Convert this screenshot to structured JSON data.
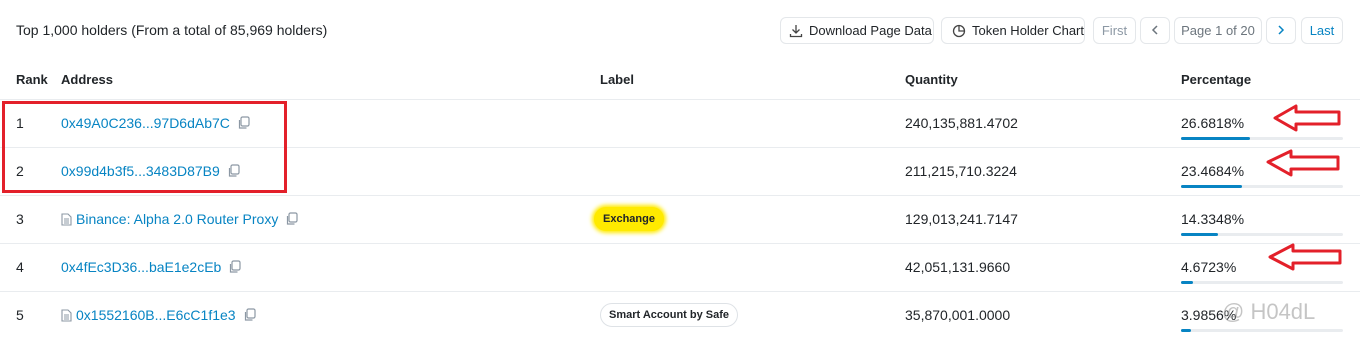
{
  "header": {
    "summary": "Top 1,000 holders (From a total of 85,969 holders)",
    "download_label": "Download Page Data",
    "chart_label": "Token Holder Chart",
    "pager": {
      "first": "First",
      "prev": "<",
      "info": "Page 1 of 20",
      "next": ">",
      "last": "Last"
    }
  },
  "columns": {
    "rank": "Rank",
    "address": "Address",
    "label": "Label",
    "quantity": "Quantity",
    "percentage": "Percentage"
  },
  "rows": [
    {
      "rank": "1",
      "address": "0x49A0C236...97D6dAb7C",
      "label": "",
      "quantity": "240,135,881.4702",
      "percentage": "26.6818%",
      "share": 0.266818
    },
    {
      "rank": "2",
      "address": "0x99d4b3f5...3483D87B9",
      "label": "",
      "quantity": "211,215,710.3224",
      "percentage": "23.4684%",
      "share": 0.234684
    },
    {
      "rank": "3",
      "address": "Binance: Alpha 2.0 Router Proxy",
      "label": "Exchange",
      "quantity": "129,013,241.7147",
      "percentage": "14.3348%",
      "share": 0.143348
    },
    {
      "rank": "4",
      "address": "0x4fEc3D36...baE1e2cEb",
      "label": "",
      "quantity": "42,051,131.9660",
      "percentage": "4.6723%",
      "share": 0.046723
    },
    {
      "rank": "5",
      "address": "0x1552160B...E6cC1f1e3",
      "label": "Smart Account by Safe",
      "quantity": "35,870,001.0000",
      "percentage": "3.9856%",
      "share": 0.039856
    }
  ],
  "watermark": "@ H04dL",
  "colors": {
    "link": "#0784c3",
    "annotation_red": "#e3202a",
    "highlight_yellow": "#ffea00"
  }
}
